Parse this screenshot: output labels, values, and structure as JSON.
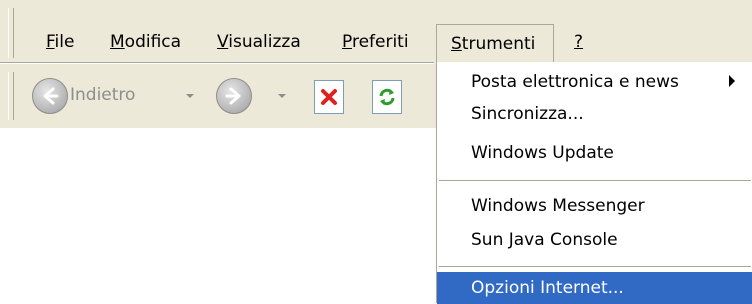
{
  "menubar": {
    "items": [
      "File",
      "Modifica",
      "Visualizza",
      "Preferiti",
      "Strumenti",
      "?"
    ],
    "active": "Strumenti"
  },
  "toolbar": {
    "back_label": "Indietro",
    "back_icon": "back-arrow-icon",
    "forward_icon": "forward-arrow-icon",
    "stop_icon": "stop-icon",
    "refresh_icon": "refresh-icon"
  },
  "tools_menu": {
    "items": [
      {
        "label": "Posta elettronica e news",
        "has_submenu": true
      },
      {
        "label": "Sincronizza..."
      },
      {
        "label": "Windows Update"
      },
      {
        "label": "Windows Messenger"
      },
      {
        "label": "Sun Java Console"
      },
      {
        "label": "Opzioni Internet...",
        "highlighted": true
      }
    ]
  },
  "colors": {
    "chrome": "#ece9d8",
    "highlight": "#316ac5",
    "stop_red": "#e02020",
    "refresh_green": "#2a9e2a"
  }
}
